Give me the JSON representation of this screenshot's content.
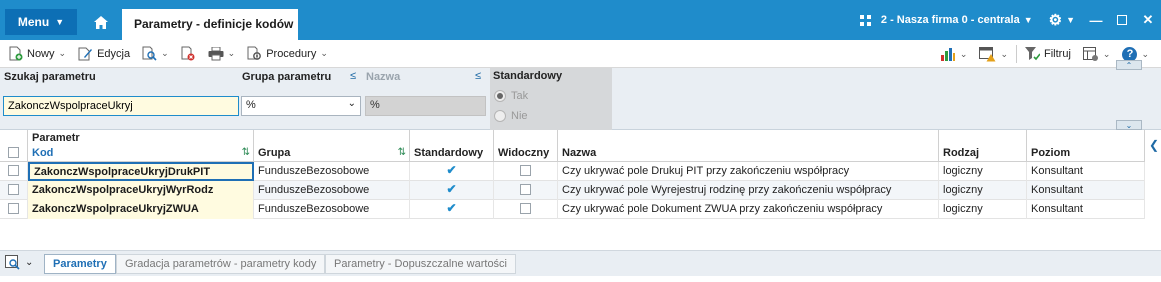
{
  "titlebar": {
    "menu_label": "Menu",
    "tab_title": "Parametry - definicje kodów",
    "company": "2 - Nasza firma 0 - centrala",
    "accent": "#1f8ccb"
  },
  "toolbar": {
    "new_label": "Nowy",
    "edit_label": "Edycja",
    "procedures_label": "Procedury",
    "filter_label": "Filtruj"
  },
  "filter": {
    "search_label": "Szukaj parametru",
    "search_value": "ZakonczWspolpraceUkryj",
    "group_label": "Grupa parametru",
    "group_value": "%",
    "name_label": "Nazwa",
    "name_value": "%",
    "standard_label": "Standardowy",
    "opt_yes": "Tak",
    "opt_no": "Nie"
  },
  "grid": {
    "group_header": "Parametr",
    "columns": {
      "kod": "Kod",
      "grupa": "Grupa",
      "standardowy": "Standardowy",
      "widoczny": "Widoczny",
      "nazwa": "Nazwa",
      "rodzaj": "Rodzaj",
      "poziom": "Poziom"
    },
    "rows": [
      {
        "kod": "ZakonczWspolpraceUkryjDrukPIT",
        "grupa": "FunduszeBezosobowe",
        "standardowy": true,
        "widoczny": false,
        "nazwa": "Czy ukrywać pole Drukuj PIT przy zakończeniu współpracy",
        "rodzaj": "logiczny",
        "poziom": "Konsultant"
      },
      {
        "kod": "ZakonczWspolpraceUkryjWyrRodz",
        "grupa": "FunduszeBezosobowe",
        "standardowy": true,
        "widoczny": false,
        "nazwa": "Czy ukrywać pole Wyrejestruj rodzinę przy zakończeniu współpracy",
        "rodzaj": "logiczny",
        "poziom": "Konsultant"
      },
      {
        "kod": "ZakonczWspolpraceUkryjZWUA",
        "grupa": "FunduszeBezosobowe",
        "standardowy": true,
        "widoczny": false,
        "nazwa": "Czy ukrywać pole Dokument ZWUA przy zakończeniu współpracy",
        "rodzaj": "logiczny",
        "poziom": "Konsultant"
      }
    ]
  },
  "bottom_tabs": [
    {
      "label": "Parametry",
      "active": true
    },
    {
      "label": "Gradacja parametrów - parametry kody",
      "active": false
    },
    {
      "label": "Parametry - Dopuszczalne wartości",
      "active": false
    }
  ]
}
